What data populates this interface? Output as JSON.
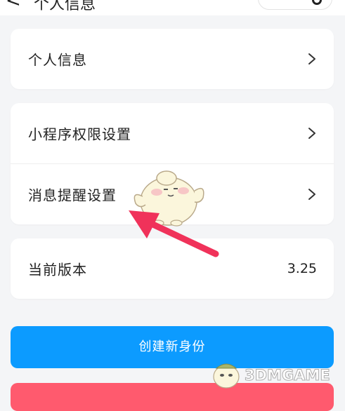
{
  "header": {
    "back_glyph": "<",
    "title": "个人信息"
  },
  "menu": {
    "personal_info": "个人信息",
    "mini_program_permissions": "小程序权限设置",
    "message_reminder": "消息提醒设置",
    "current_version_label": "当前版本",
    "current_version_value": "3.25"
  },
  "actions": {
    "create_identity": "创建新身份"
  },
  "watermark": {
    "text": "3DMGAME"
  },
  "colors": {
    "primary": "#0c9bff",
    "danger": "#ff5a6e",
    "arrow": "#f0325a",
    "background": "#f4f5f7"
  },
  "icons": [
    "chevron-right-icon",
    "back-icon",
    "capsule-close-icon"
  ]
}
